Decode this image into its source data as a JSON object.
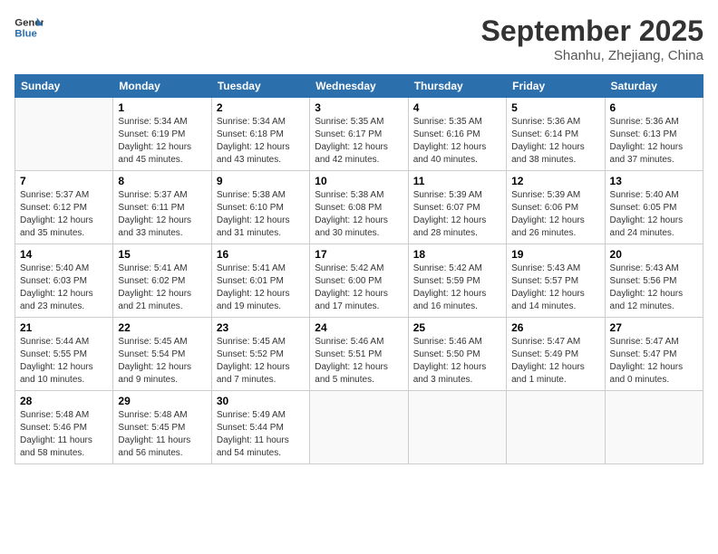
{
  "header": {
    "logo_line1": "General",
    "logo_line2": "Blue",
    "month_title": "September 2025",
    "location": "Shanhu, Zhejiang, China"
  },
  "weekdays": [
    "Sunday",
    "Monday",
    "Tuesday",
    "Wednesday",
    "Thursday",
    "Friday",
    "Saturday"
  ],
  "weeks": [
    [
      {
        "day": "",
        "info": ""
      },
      {
        "day": "1",
        "info": "Sunrise: 5:34 AM\nSunset: 6:19 PM\nDaylight: 12 hours\nand 45 minutes."
      },
      {
        "day": "2",
        "info": "Sunrise: 5:34 AM\nSunset: 6:18 PM\nDaylight: 12 hours\nand 43 minutes."
      },
      {
        "day": "3",
        "info": "Sunrise: 5:35 AM\nSunset: 6:17 PM\nDaylight: 12 hours\nand 42 minutes."
      },
      {
        "day": "4",
        "info": "Sunrise: 5:35 AM\nSunset: 6:16 PM\nDaylight: 12 hours\nand 40 minutes."
      },
      {
        "day": "5",
        "info": "Sunrise: 5:36 AM\nSunset: 6:14 PM\nDaylight: 12 hours\nand 38 minutes."
      },
      {
        "day": "6",
        "info": "Sunrise: 5:36 AM\nSunset: 6:13 PM\nDaylight: 12 hours\nand 37 minutes."
      }
    ],
    [
      {
        "day": "7",
        "info": "Sunrise: 5:37 AM\nSunset: 6:12 PM\nDaylight: 12 hours\nand 35 minutes."
      },
      {
        "day": "8",
        "info": "Sunrise: 5:37 AM\nSunset: 6:11 PM\nDaylight: 12 hours\nand 33 minutes."
      },
      {
        "day": "9",
        "info": "Sunrise: 5:38 AM\nSunset: 6:10 PM\nDaylight: 12 hours\nand 31 minutes."
      },
      {
        "day": "10",
        "info": "Sunrise: 5:38 AM\nSunset: 6:08 PM\nDaylight: 12 hours\nand 30 minutes."
      },
      {
        "day": "11",
        "info": "Sunrise: 5:39 AM\nSunset: 6:07 PM\nDaylight: 12 hours\nand 28 minutes."
      },
      {
        "day": "12",
        "info": "Sunrise: 5:39 AM\nSunset: 6:06 PM\nDaylight: 12 hours\nand 26 minutes."
      },
      {
        "day": "13",
        "info": "Sunrise: 5:40 AM\nSunset: 6:05 PM\nDaylight: 12 hours\nand 24 minutes."
      }
    ],
    [
      {
        "day": "14",
        "info": "Sunrise: 5:40 AM\nSunset: 6:03 PM\nDaylight: 12 hours\nand 23 minutes."
      },
      {
        "day": "15",
        "info": "Sunrise: 5:41 AM\nSunset: 6:02 PM\nDaylight: 12 hours\nand 21 minutes."
      },
      {
        "day": "16",
        "info": "Sunrise: 5:41 AM\nSunset: 6:01 PM\nDaylight: 12 hours\nand 19 minutes."
      },
      {
        "day": "17",
        "info": "Sunrise: 5:42 AM\nSunset: 6:00 PM\nDaylight: 12 hours\nand 17 minutes."
      },
      {
        "day": "18",
        "info": "Sunrise: 5:42 AM\nSunset: 5:59 PM\nDaylight: 12 hours\nand 16 minutes."
      },
      {
        "day": "19",
        "info": "Sunrise: 5:43 AM\nSunset: 5:57 PM\nDaylight: 12 hours\nand 14 minutes."
      },
      {
        "day": "20",
        "info": "Sunrise: 5:43 AM\nSunset: 5:56 PM\nDaylight: 12 hours\nand 12 minutes."
      }
    ],
    [
      {
        "day": "21",
        "info": "Sunrise: 5:44 AM\nSunset: 5:55 PM\nDaylight: 12 hours\nand 10 minutes."
      },
      {
        "day": "22",
        "info": "Sunrise: 5:45 AM\nSunset: 5:54 PM\nDaylight: 12 hours\nand 9 minutes."
      },
      {
        "day": "23",
        "info": "Sunrise: 5:45 AM\nSunset: 5:52 PM\nDaylight: 12 hours\nand 7 minutes."
      },
      {
        "day": "24",
        "info": "Sunrise: 5:46 AM\nSunset: 5:51 PM\nDaylight: 12 hours\nand 5 minutes."
      },
      {
        "day": "25",
        "info": "Sunrise: 5:46 AM\nSunset: 5:50 PM\nDaylight: 12 hours\nand 3 minutes."
      },
      {
        "day": "26",
        "info": "Sunrise: 5:47 AM\nSunset: 5:49 PM\nDaylight: 12 hours\nand 1 minute."
      },
      {
        "day": "27",
        "info": "Sunrise: 5:47 AM\nSunset: 5:47 PM\nDaylight: 12 hours\nand 0 minutes."
      }
    ],
    [
      {
        "day": "28",
        "info": "Sunrise: 5:48 AM\nSunset: 5:46 PM\nDaylight: 11 hours\nand 58 minutes."
      },
      {
        "day": "29",
        "info": "Sunrise: 5:48 AM\nSunset: 5:45 PM\nDaylight: 11 hours\nand 56 minutes."
      },
      {
        "day": "30",
        "info": "Sunrise: 5:49 AM\nSunset: 5:44 PM\nDaylight: 11 hours\nand 54 minutes."
      },
      {
        "day": "",
        "info": ""
      },
      {
        "day": "",
        "info": ""
      },
      {
        "day": "",
        "info": ""
      },
      {
        "day": "",
        "info": ""
      }
    ]
  ]
}
